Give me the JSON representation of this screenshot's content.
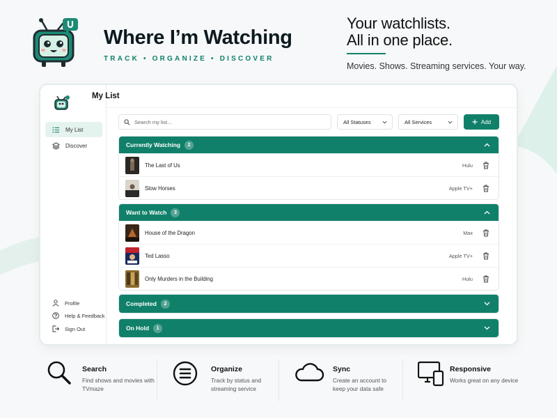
{
  "brand": {
    "title": "Where I’m Watching",
    "tagline": "TRACK  •  ORGANIZE  •  DISCOVER",
    "logo_badge": "u"
  },
  "hero": {
    "line1": "Your watchlists.",
    "line2": "All in one place.",
    "sub": "Movies. Shows. Streaming services. Your way."
  },
  "colors": {
    "accent": "#11806a",
    "accent_soft": "#e5f3ef",
    "swoosh": "#dbeee8"
  },
  "app": {
    "page_title": "My List",
    "sidebar": {
      "nav": [
        {
          "label": "My List",
          "icon": "list-icon",
          "active": true
        },
        {
          "label": "Discover",
          "icon": "layers-icon",
          "active": false
        }
      ],
      "footer": [
        {
          "label": "Profile",
          "icon": "user-icon"
        },
        {
          "label": "Help & Feedback",
          "icon": "help-icon"
        },
        {
          "label": "Sign Out",
          "icon": "sign-out-icon"
        }
      ]
    },
    "toolbar": {
      "search_placeholder": "Search my list...",
      "status_filter": "All Statuses",
      "service_filter": "All Services",
      "add_label": "Add"
    },
    "groups": [
      {
        "name": "Currently Watching",
        "count": "2",
        "expanded": true,
        "items": [
          {
            "title": "The Last of Us",
            "service": "Hulu"
          },
          {
            "title": "Slow Horses",
            "service": "Apple TV+"
          }
        ]
      },
      {
        "name": "Want to Watch",
        "count": "3",
        "expanded": true,
        "items": [
          {
            "title": "House of the Dragon",
            "service": "Max"
          },
          {
            "title": "Ted Lasso",
            "service": "Apple TV+"
          },
          {
            "title": "Only Murders in the Building",
            "service": "Hulu"
          }
        ]
      },
      {
        "name": "Completed",
        "count": "2",
        "expanded": false,
        "items": []
      },
      {
        "name": "On Hold",
        "count": "1",
        "expanded": false,
        "items": []
      }
    ]
  },
  "features": [
    {
      "title": "Search",
      "desc": "Find shows and movies with TVmaze",
      "icon": "magnifier-icon"
    },
    {
      "title": "Organize",
      "desc": "Track by status and streaming service",
      "icon": "organize-icon"
    },
    {
      "title": "Sync",
      "desc": "Create an account to keep your data safe",
      "icon": "cloud-icon"
    },
    {
      "title": "Responsive",
      "desc": "Works great on any device",
      "icon": "devices-icon"
    }
  ]
}
